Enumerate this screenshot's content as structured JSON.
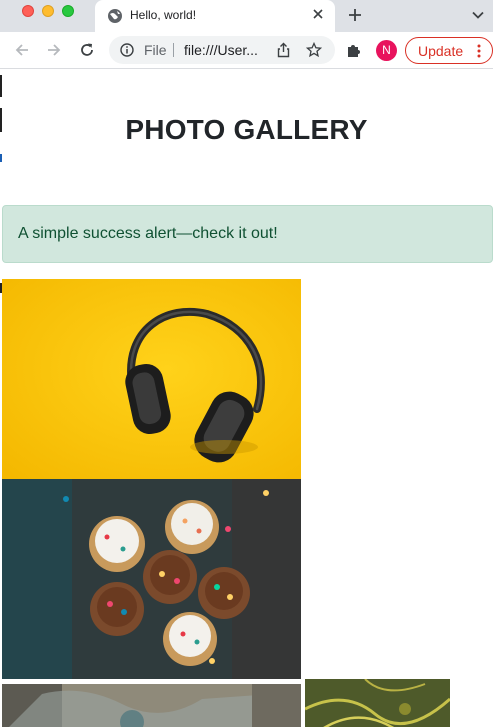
{
  "browser": {
    "tab": {
      "title": "Hello, world!",
      "icon": "globe-icon"
    },
    "omnibox": {
      "scheme_label": "File",
      "url": "file:///User..."
    },
    "profile_initial": "N",
    "update_label": "Update",
    "colors": {
      "tabstrip": "#dee1e6",
      "accent_update": "#d93025",
      "avatar": "#e8135d"
    }
  },
  "page": {
    "title": "PHOTO GALLERY",
    "alert": {
      "text": "A simple success alert—check it out!",
      "color": "#0f5132",
      "background": "#d1e7dd"
    },
    "photos": [
      {
        "subject": "headphones on yellow background"
      },
      {
        "subject": "frosted cupcakes with sprinkles"
      },
      {
        "subject": "partially visible photo"
      },
      {
        "subject": "partially visible green foliage photo"
      }
    ]
  }
}
